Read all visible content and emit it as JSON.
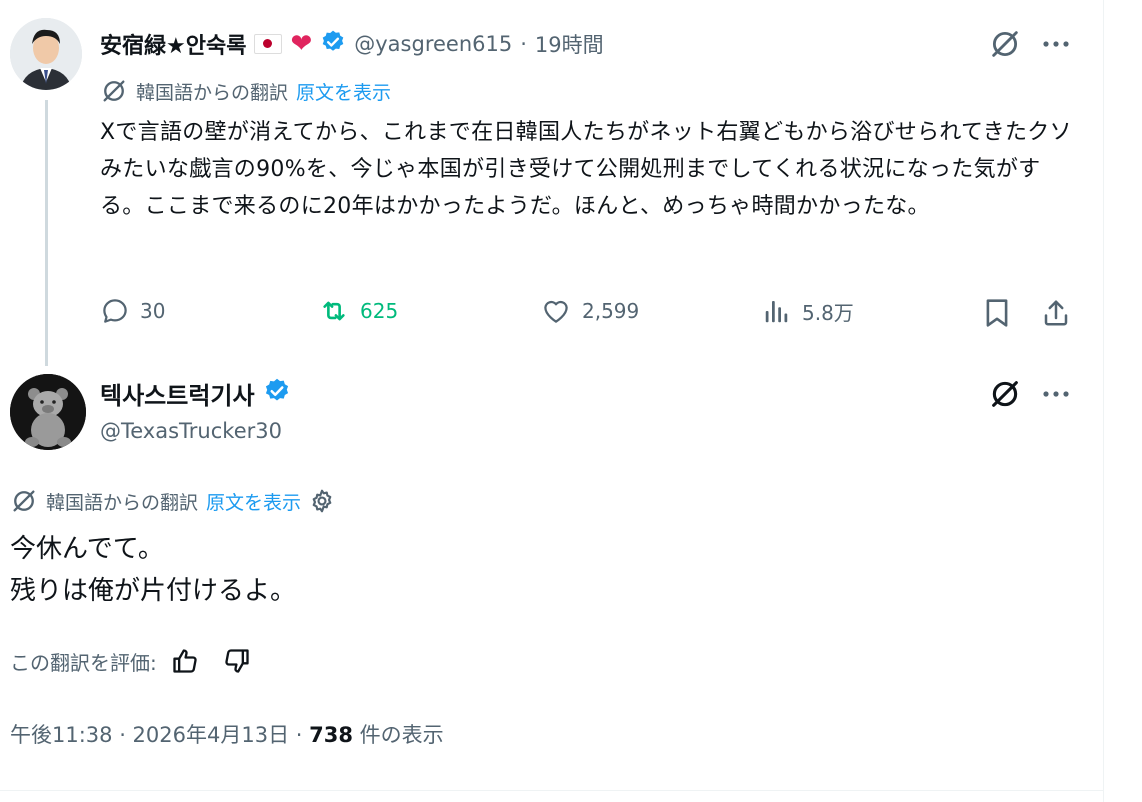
{
  "tweet1": {
    "display_name": "安宿緑★안숙록",
    "flag_icon": "japan-flag-icon",
    "heart": "❤",
    "handle": "@yasgreen615",
    "dot": "·",
    "time": "19時間",
    "translation_note": "韓国語からの翻訳",
    "show_original": "原文を表示",
    "body": "Xで言語の壁が消えてから、これまで在日韓国人たちがネット右翼どもから浴びせられてきたクソみたいな戯言の90%を、今じゃ本国が引き受けて公開処刑までしてくれる状況になった気がする。ここまで来るのに20年はかかったようだ。ほんと、めっちゃ時間かかったな。",
    "replies": "30",
    "reposts": "625",
    "likes": "2,599",
    "views": "5.8万"
  },
  "tweet2": {
    "display_name": "텍사스트럭기사",
    "handle": "@TexasTrucker30",
    "translation_note": "韓国語からの翻訳",
    "show_original": "原文を表示",
    "body_line1": "今休んでて。",
    "body_line2": "残りは俺が片付けるよ。",
    "rate_label": "この翻訳を評価:",
    "timestamp": "午後11:38 · 2026年4月13日 · ",
    "view_count": "738",
    "view_suffix": " 件の表示"
  },
  "colors": {
    "text": "#0f1419",
    "muted": "#536471",
    "accent": "#1d9bf0",
    "repost_active": "#00ba7c",
    "thread_line": "#cfd9de"
  }
}
